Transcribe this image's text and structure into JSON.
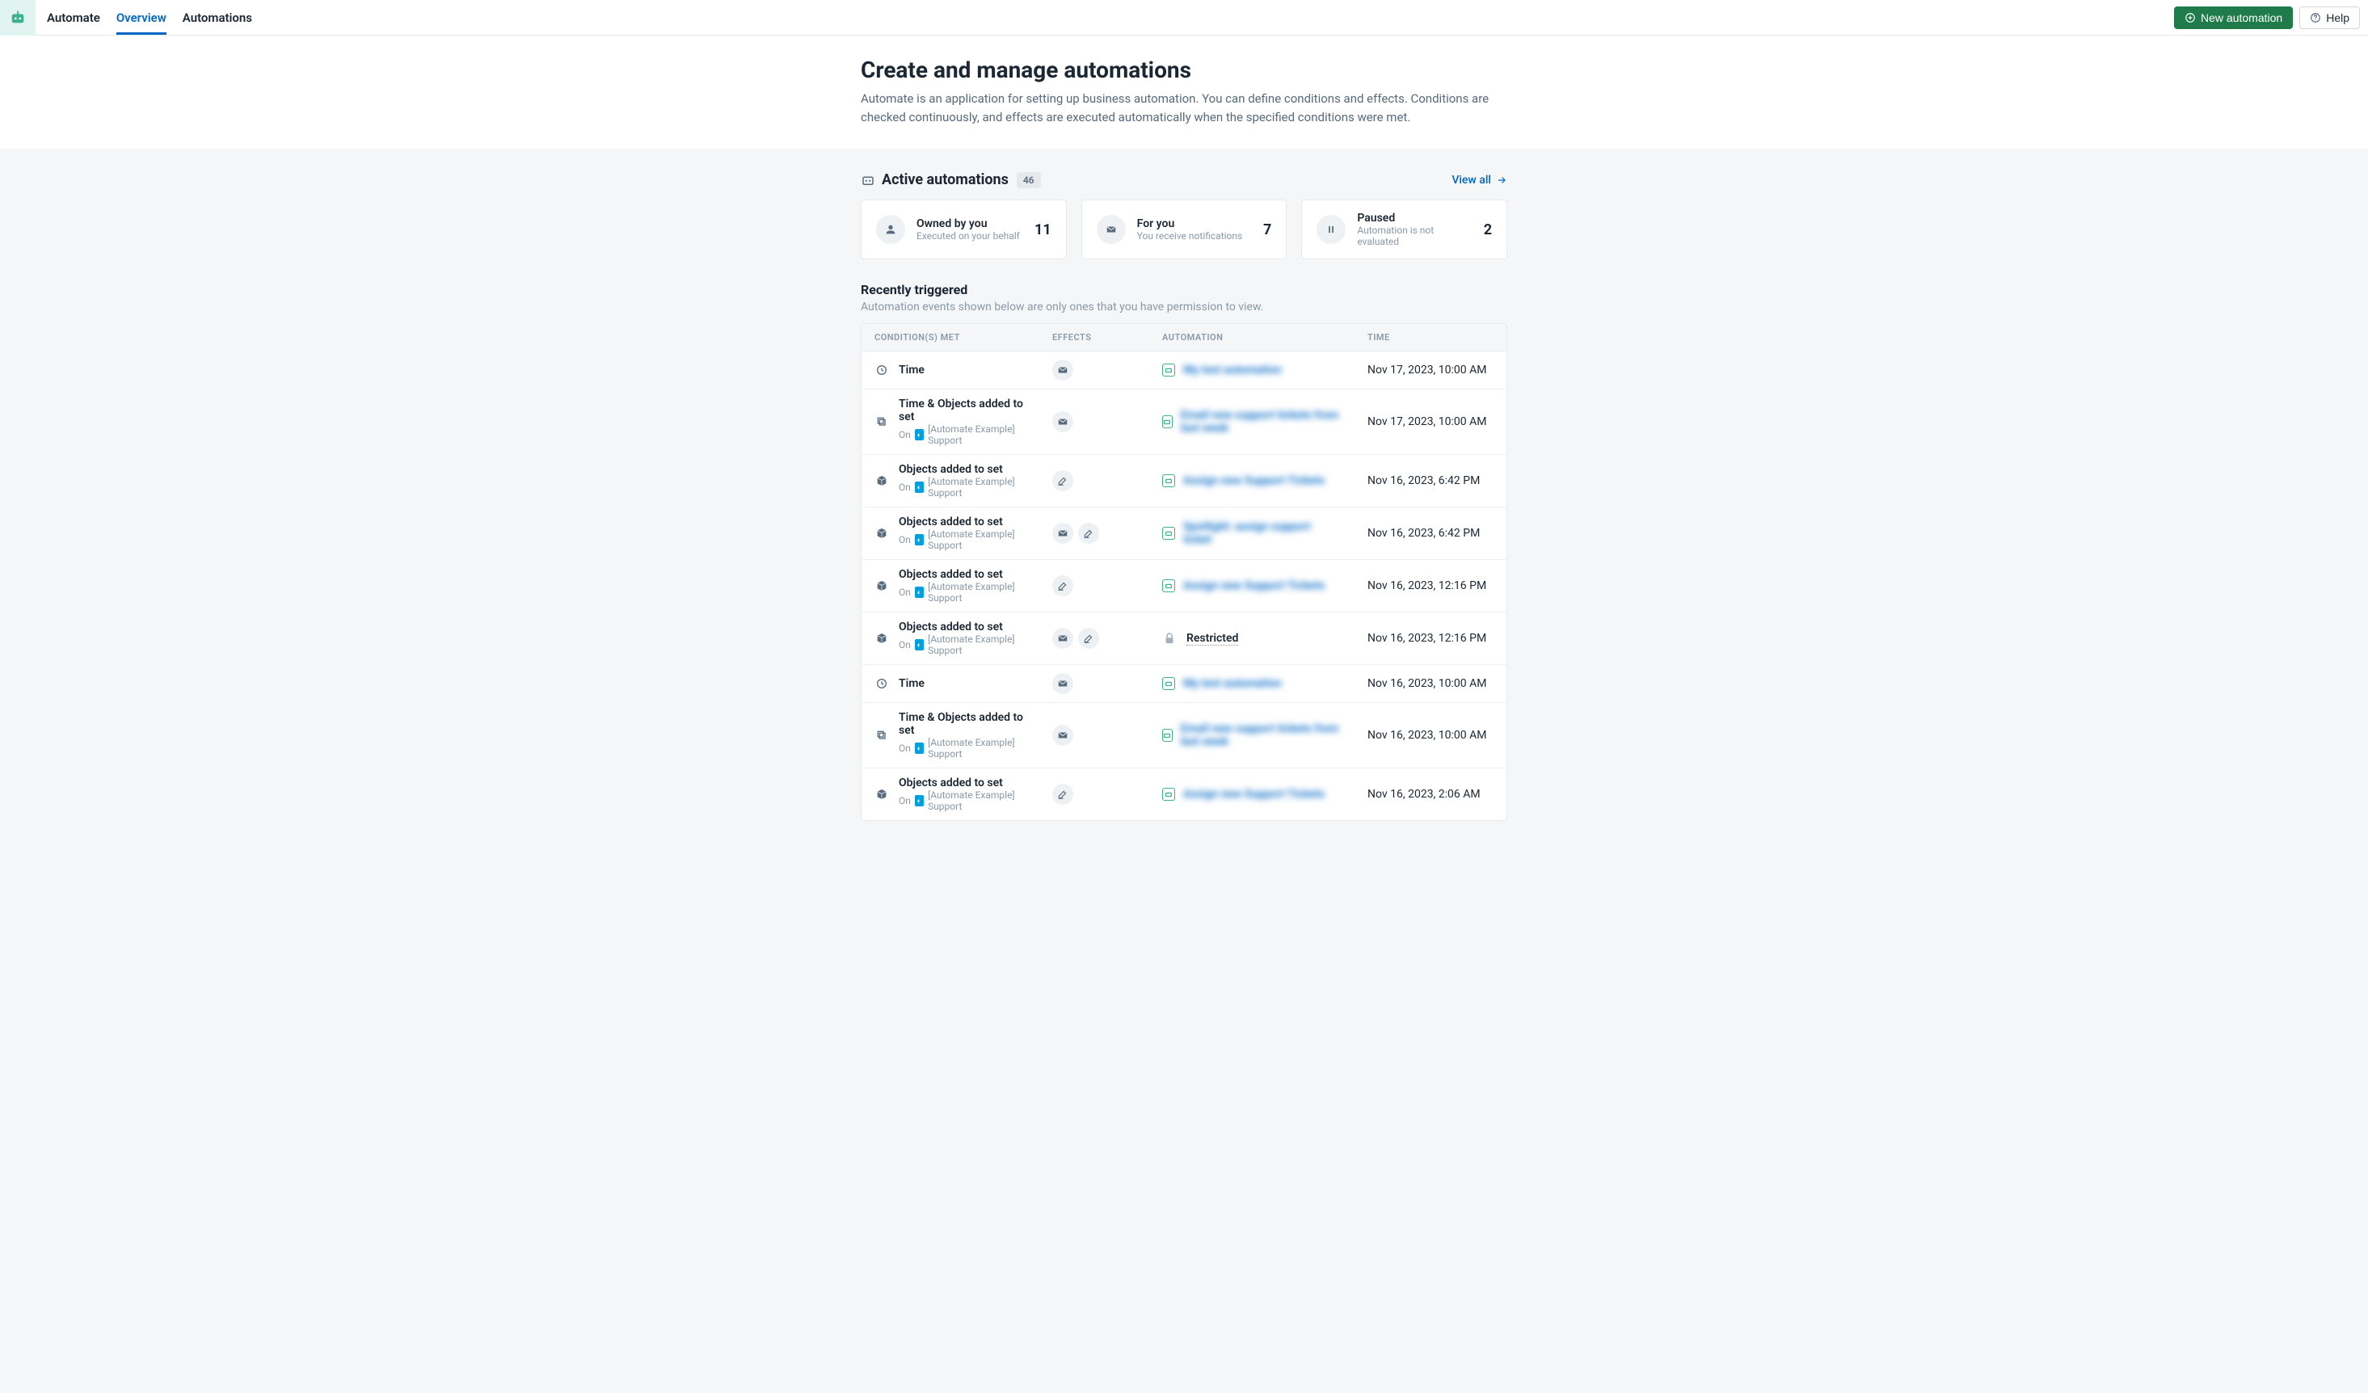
{
  "header": {
    "brand": "Automate",
    "tabs": [
      "Overview",
      "Automations"
    ],
    "active_tab": 0,
    "new_button": "New automation",
    "help_button": "Help"
  },
  "hero": {
    "title": "Create and manage automations",
    "subtitle": "Automate is an application for setting up business automation. You can define conditions and effects. Conditions are checked continuously, and effects are executed automatically when the specified conditions were met."
  },
  "active": {
    "label": "Active automations",
    "count": "46",
    "view_all": "View all",
    "cards": [
      {
        "title": "Owned by you",
        "sub": "Executed on your behalf",
        "num": "11",
        "icon": "user"
      },
      {
        "title": "For you",
        "sub": "You receive notifications",
        "num": "7",
        "icon": "mail"
      },
      {
        "title": "Paused",
        "sub": "Automation is not evaluated",
        "num": "2",
        "icon": "pause"
      }
    ]
  },
  "recent": {
    "title": "Recently triggered",
    "sub": "Automation events shown below are only ones that you have permission to view.",
    "columns": [
      "CONDITION(S) MET",
      "EFFECTS",
      "AUTOMATION",
      "TIME"
    ],
    "on_label": "On",
    "support_label": "[Automate Example] Support",
    "restricted_label": "Restricted",
    "rows": [
      {
        "icon": "clock",
        "title": "Time",
        "sub": false,
        "effects": [
          "mail"
        ],
        "auto": "My test automation",
        "time": "Nov 17, 2023, 10:00 AM"
      },
      {
        "icon": "copy",
        "title": "Time & Objects added to set",
        "sub": true,
        "effects": [
          "mail"
        ],
        "auto": "Email new support tickets from last week",
        "time": "Nov 17, 2023, 10:00 AM"
      },
      {
        "icon": "cube",
        "title": "Objects added to set",
        "sub": true,
        "effects": [
          "pencil"
        ],
        "auto": "Assign new Support Tickets",
        "time": "Nov 16, 2023, 6:42 PM"
      },
      {
        "icon": "cube",
        "title": "Objects added to set",
        "sub": true,
        "effects": [
          "mail",
          "pencil"
        ],
        "auto": "Spotlight: assign support ticket",
        "time": "Nov 16, 2023, 6:42 PM"
      },
      {
        "icon": "cube",
        "title": "Objects added to set",
        "sub": true,
        "effects": [
          "pencil"
        ],
        "auto": "Assign new Support Tickets",
        "time": "Nov 16, 2023, 12:16 PM"
      },
      {
        "icon": "cube",
        "title": "Objects added to set",
        "sub": true,
        "effects": [
          "mail",
          "pencil"
        ],
        "restricted": true,
        "time": "Nov 16, 2023, 12:16 PM"
      },
      {
        "icon": "clock",
        "title": "Time",
        "sub": false,
        "effects": [
          "mail"
        ],
        "auto": "My test automation",
        "time": "Nov 16, 2023, 10:00 AM"
      },
      {
        "icon": "copy",
        "title": "Time & Objects added to set",
        "sub": true,
        "effects": [
          "mail"
        ],
        "auto": "Email new support tickets from last week",
        "time": "Nov 16, 2023, 10:00 AM"
      },
      {
        "icon": "cube",
        "title": "Objects added to set",
        "sub": true,
        "effects": [
          "pencil"
        ],
        "auto": "Assign new Support Tickets",
        "time": "Nov 16, 2023, 2:06 AM"
      }
    ]
  }
}
